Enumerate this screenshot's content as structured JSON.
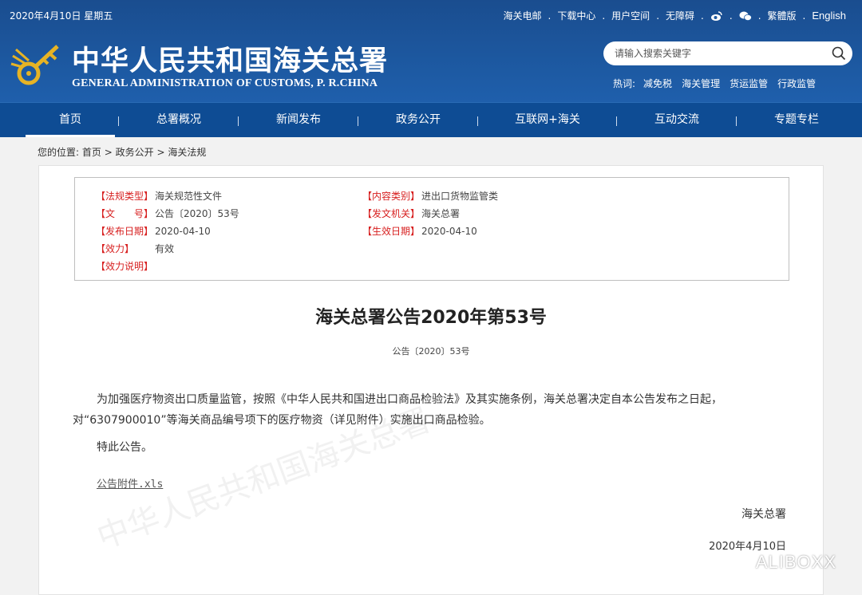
{
  "header": {
    "date": "2020年4月10日 星期五",
    "links": [
      "海关电邮",
      "下载中心",
      "用户空间",
      "无障碍"
    ],
    "icons": [
      "weibo-icon",
      "wechat-icon"
    ],
    "traditional": "繁體版",
    "english": "English",
    "logo_cn": "中华人民共和国海关总署",
    "logo_en": "GENERAL ADMINISTRATION OF CUSTOMS, P. R.CHINA"
  },
  "search": {
    "placeholder": "请输入搜索关键字",
    "hot_label": "热词:",
    "hot_words": [
      "减免税",
      "海关管理",
      "货运监管",
      "行政监管"
    ]
  },
  "nav": {
    "items": [
      "首页",
      "总署概况",
      "新闻发布",
      "政务公开",
      "互联网+海关",
      "互动交流",
      "专题专栏"
    ],
    "active": "首页"
  },
  "breadcrumb": {
    "prefix": "您的位置:",
    "items": [
      "首页",
      "政务公开",
      "海关法规"
    ],
    "separator": ">"
  },
  "info": {
    "law_type_label": "【法规类型】",
    "law_type": "海关规范性文件",
    "content_type_label": "【内容类别】",
    "content_type": "进出口货物监管类",
    "doc_no_label": "【文　　号】",
    "doc_no": "公告〔2020〕53号",
    "issuer_label": "【发文机关】",
    "issuer": "海关总署",
    "publish_date_label": "【发布日期】",
    "publish_date": "2020-04-10",
    "effective_date_label": "【生效日期】",
    "effective_date": "2020-04-10",
    "validity_label": "【效力】",
    "validity": "有效",
    "validity_note_label": "【效力说明】"
  },
  "article": {
    "title": "海关总署公告2020年第53号",
    "doc_no": "公告〔2020〕53号",
    "paragraph1": "为加强医疗物资出口质量监管，按照《中华人民共和国进出口商品检验法》及其实施条例，海关总署决定自本公告发布之日起，对“6307900010”等海关商品编号项下的医疗物资（详见附件）实施出口商品检验。",
    "paragraph2": "特此公告。",
    "attachment": "公告附件.xls",
    "signature": "海关总署",
    "sign_date": "2020年4月10日"
  },
  "watermark_text": "中华人民共和国海关总署",
  "brand": "ALIBOXX",
  "colors": {
    "header_blue": "#1d5aa3",
    "nav_blue": "#0e4c94",
    "label_red": "#d71f1f"
  }
}
